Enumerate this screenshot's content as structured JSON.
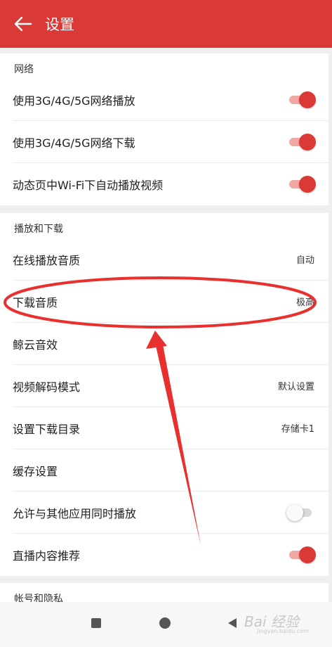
{
  "header": {
    "title": "设置",
    "back_icon": "arrow-left-icon"
  },
  "sections": {
    "network": {
      "title": "网络",
      "items": [
        {
          "label": "使用3G/4G/5G网络播放",
          "toggle": true
        },
        {
          "label": "使用3G/4G/5G网络下载",
          "toggle": true
        },
        {
          "label": "动态页中Wi-Fi下自动播放视频",
          "toggle": true
        }
      ]
    },
    "playback": {
      "title": "播放和下载",
      "items": [
        {
          "label": "在线播放音质",
          "value": "自动"
        },
        {
          "label": "下载音质",
          "value": "极高"
        },
        {
          "label": "鲸云音效",
          "value": ""
        },
        {
          "label": "视频解码模式",
          "value": "默认设置"
        },
        {
          "label": "设置下载目录",
          "value": "存储卡1"
        },
        {
          "label": "缓存设置",
          "value": ""
        },
        {
          "label": "允许与其他应用同时播放",
          "toggle": false
        },
        {
          "label": "直播内容推荐",
          "toggle": true
        }
      ]
    },
    "account": {
      "title": "帐号和隐私"
    }
  },
  "navbar": {
    "recent_icon": "square-icon",
    "home_icon": "circle-icon",
    "back_icon": "triangle-back-icon"
  },
  "watermark": {
    "text": "Bai  经验",
    "sub": "jingyan.baidu.com"
  },
  "colors": {
    "accent": "#d93a36",
    "annotation": "#e8302f"
  }
}
